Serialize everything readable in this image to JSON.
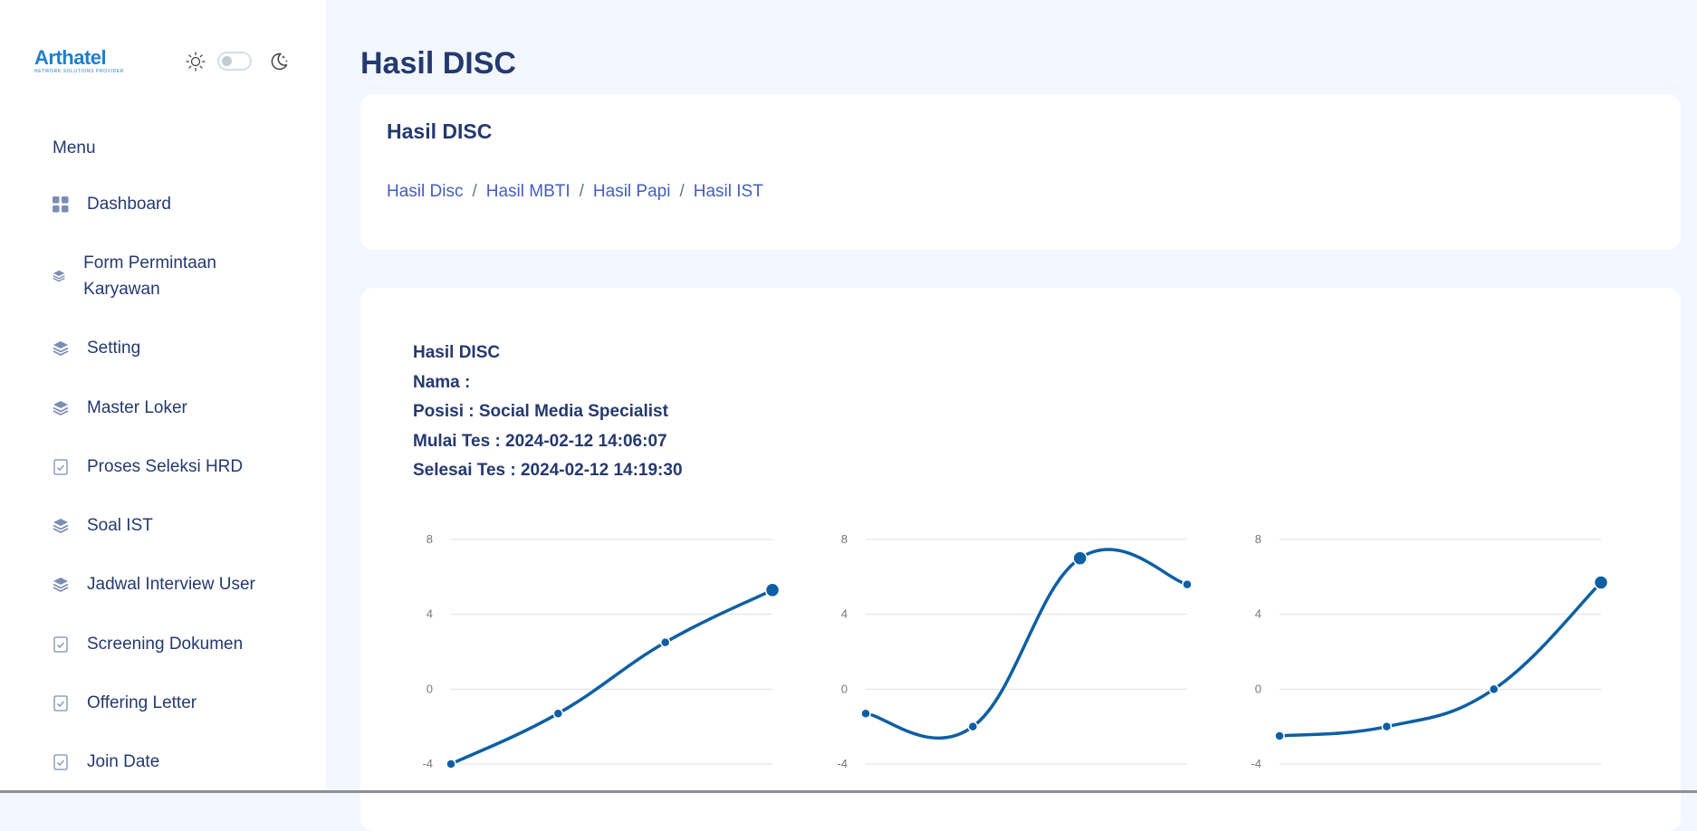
{
  "brand": {
    "name": "Arthatel",
    "tagline": "NETWORK SOLUTIONS PROVIDER"
  },
  "sidebar": {
    "menu_title": "Menu",
    "items": [
      {
        "label": "Dashboard",
        "icon": "grid-icon"
      },
      {
        "label": "Form Permintaan Karyawan",
        "icon": "stack-icon"
      },
      {
        "label": "Setting",
        "icon": "stack-icon"
      },
      {
        "label": "Master Loker",
        "icon": "stack-icon"
      },
      {
        "label": "Proses Seleksi HRD",
        "icon": "checklist-icon"
      },
      {
        "label": "Soal IST",
        "icon": "stack-icon"
      },
      {
        "label": "Jadwal Interview User",
        "icon": "stack-icon"
      },
      {
        "label": "Screening Dokumen",
        "icon": "checklist-icon"
      },
      {
        "label": "Offering Letter",
        "icon": "checklist-icon"
      },
      {
        "label": "Join Date",
        "icon": "checklist-icon"
      }
    ]
  },
  "page": {
    "title": "Hasil DISC",
    "card_title": "Hasil DISC",
    "breadcrumb": [
      "Hasil Disc",
      "Hasil MBTI",
      "Hasil Papi",
      "Hasil IST"
    ]
  },
  "result": {
    "heading": "Hasil DISC",
    "nama": "Nama :",
    "posisi": "Posisi : Social Media Specialist",
    "mulai": "Mulai Tes : 2024-02-12 14:06:07",
    "selesai": "Selesai Tes : 2024-02-12 14:19:30"
  },
  "colors": {
    "line": "#0d5fa3",
    "accent": "#435ebe",
    "text": "#25396f",
    "background": "#f2f7ff"
  },
  "chart_data": [
    {
      "type": "line",
      "x": [
        1,
        2,
        3,
        4
      ],
      "values": [
        -4,
        -1.3,
        2.5,
        5.3
      ],
      "ylim": [
        -4,
        8
      ],
      "yticks": [
        8,
        4,
        0,
        -4
      ],
      "grid": true
    },
    {
      "type": "line",
      "x": [
        1,
        2,
        3,
        4
      ],
      "values": [
        -1.3,
        -2,
        7,
        5.6
      ],
      "ylim": [
        -4,
        8
      ],
      "yticks": [
        8,
        4,
        0,
        -4
      ],
      "grid": true
    },
    {
      "type": "line",
      "x": [
        1,
        2,
        3,
        4
      ],
      "values": [
        -2.5,
        -2,
        0,
        5.7
      ],
      "ylim": [
        -4,
        8
      ],
      "yticks": [
        8,
        4,
        0,
        -4
      ],
      "grid": true
    }
  ]
}
